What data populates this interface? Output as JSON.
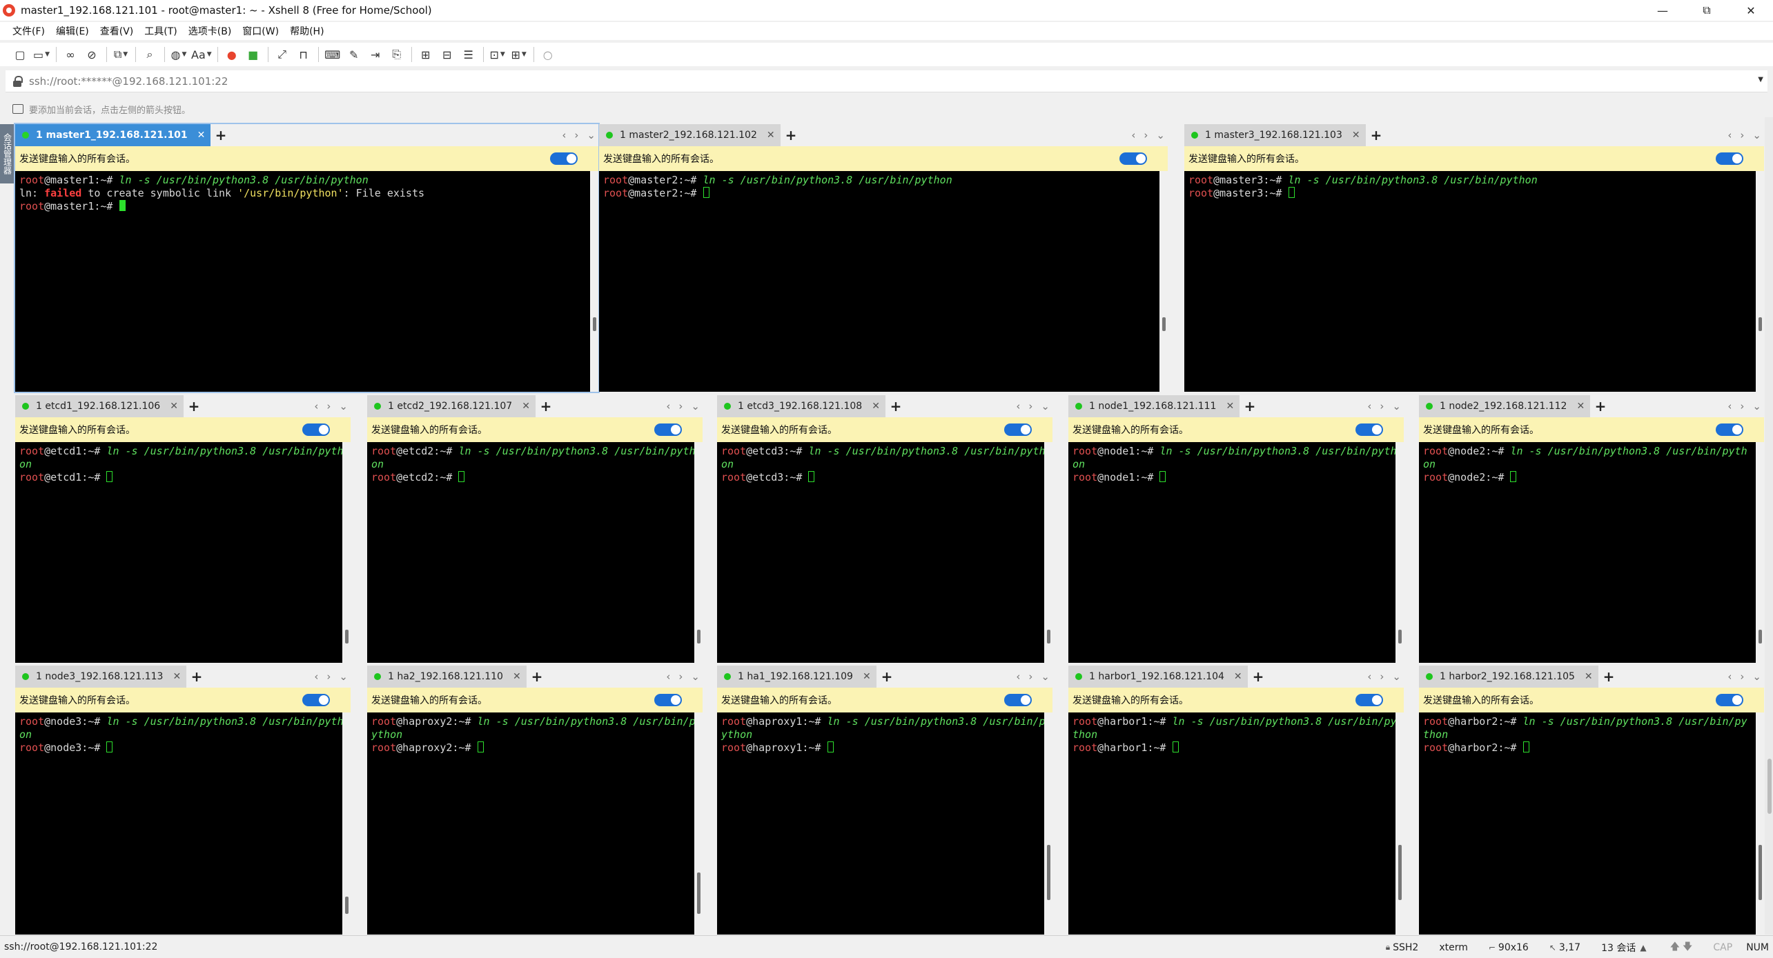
{
  "window": {
    "title": "master1_192.168.121.101 - root@master1: ~ - Xshell 8 (Free for Home/School)",
    "controls": {
      "minimize": "—",
      "restore": "⧉",
      "close": "✕"
    }
  },
  "menu": [
    "文件(F)",
    "编辑(E)",
    "查看(V)",
    "工具(T)",
    "选项卡(B)",
    "窗口(W)",
    "帮助(H)"
  ],
  "address": {
    "value": "ssh://root:******@192.168.121.101:22"
  },
  "hint": "要添加当前会话，点击左侧的箭头按钮。",
  "sidebar_label": "会话管理器",
  "send_label": "发送键盘输入的所有会话。",
  "status": {
    "left": "ssh://root@192.168.121.101:22",
    "protocol": "SSH2",
    "term": "xterm",
    "size": "90x16",
    "pos": "3,17",
    "sessions": "13 会话",
    "cap": "CAP",
    "num": "NUM"
  },
  "panes": [
    {
      "tab": "1 master1_192.168.121.101",
      "active": true,
      "host": "master1",
      "lines": [
        [
          [
            "p-root",
            "root"
          ],
          [
            "p-host",
            "@master1:~# "
          ],
          [
            "c-cmd",
            "ln -s /usr/bin/python3.8 /usr/bin/python"
          ]
        ],
        [
          [
            "c-plain",
            "ln: "
          ],
          [
            "c-red",
            "failed"
          ],
          [
            "c-plain",
            " to create symbolic link "
          ],
          [
            "c-str",
            "'/usr/bin/python'"
          ],
          [
            "c-plain",
            ": File exists"
          ]
        ],
        [
          [
            "p-root",
            "root"
          ],
          [
            "p-host",
            "@master1:~# "
          ],
          [
            "cursor",
            "block"
          ]
        ]
      ]
    },
    {
      "tab": "1 master2_192.168.121.102",
      "active": false,
      "host": "master2",
      "lines": [
        [
          [
            "p-root",
            "root"
          ],
          [
            "p-host",
            "@master2:~# "
          ],
          [
            "c-cmd",
            "ln -s /usr/bin/python3.8 /usr/bin/python"
          ]
        ],
        [
          [
            "p-root",
            "root"
          ],
          [
            "p-host",
            "@master2:~# "
          ],
          [
            "cursor",
            "hollow"
          ]
        ]
      ]
    },
    {
      "tab": "1 master3_192.168.121.103",
      "active": false,
      "host": "master3",
      "lines": [
        [
          [
            "p-root",
            "root"
          ],
          [
            "p-host",
            "@master3:~# "
          ],
          [
            "c-cmd",
            "ln -s /usr/bin/python3.8 /usr/bin/python"
          ]
        ],
        [
          [
            "p-root",
            "root"
          ],
          [
            "p-host",
            "@master3:~# "
          ],
          [
            "cursor",
            "hollow"
          ]
        ]
      ]
    },
    {
      "tab": "1 etcd1_192.168.121.106",
      "active": false,
      "host": "etcd1",
      "lines": [
        [
          [
            "p-root",
            "root"
          ],
          [
            "p-host",
            "@etcd1:~# "
          ],
          [
            "c-cmd",
            "ln -s /usr/bin/python3.8 /usr/bin/pyth"
          ]
        ],
        [
          [
            "c-cmd",
            "on"
          ]
        ],
        [
          [
            "p-root",
            "root"
          ],
          [
            "p-host",
            "@etcd1:~# "
          ],
          [
            "cursor",
            "hollow"
          ]
        ]
      ]
    },
    {
      "tab": "1 etcd2_192.168.121.107",
      "active": false,
      "host": "etcd2",
      "lines": [
        [
          [
            "p-root",
            "root"
          ],
          [
            "p-host",
            "@etcd2:~# "
          ],
          [
            "c-cmd",
            "ln -s /usr/bin/python3.8 /usr/bin/pyth"
          ]
        ],
        [
          [
            "c-cmd",
            "on"
          ]
        ],
        [
          [
            "p-root",
            "root"
          ],
          [
            "p-host",
            "@etcd2:~# "
          ],
          [
            "cursor",
            "hollow"
          ]
        ]
      ]
    },
    {
      "tab": "1 etcd3_192.168.121.108",
      "active": false,
      "host": "etcd3",
      "lines": [
        [
          [
            "p-root",
            "root"
          ],
          [
            "p-host",
            "@etcd3:~# "
          ],
          [
            "c-cmd",
            "ln -s /usr/bin/python3.8 /usr/bin/pyth"
          ]
        ],
        [
          [
            "c-cmd",
            "on"
          ]
        ],
        [
          [
            "p-root",
            "root"
          ],
          [
            "p-host",
            "@etcd3:~# "
          ],
          [
            "cursor",
            "hollow"
          ]
        ]
      ]
    },
    {
      "tab": "1 node1_192.168.121.111",
      "active": false,
      "host": "node1",
      "lines": [
        [
          [
            "p-root",
            "root"
          ],
          [
            "p-host",
            "@node1:~# "
          ],
          [
            "c-cmd",
            "ln -s /usr/bin/python3.8 /usr/bin/pyth"
          ]
        ],
        [
          [
            "c-cmd",
            "on"
          ]
        ],
        [
          [
            "p-root",
            "root"
          ],
          [
            "p-host",
            "@node1:~# "
          ],
          [
            "cursor",
            "hollow"
          ]
        ]
      ]
    },
    {
      "tab": "1 node2_192.168.121.112",
      "active": false,
      "host": "node2",
      "lines": [
        [
          [
            "p-root",
            "root"
          ],
          [
            "p-host",
            "@node2:~# "
          ],
          [
            "c-cmd",
            "ln -s /usr/bin/python3.8 /usr/bin/pyth"
          ]
        ],
        [
          [
            "c-cmd",
            "on"
          ]
        ],
        [
          [
            "p-root",
            "root"
          ],
          [
            "p-host",
            "@node2:~# "
          ],
          [
            "cursor",
            "hollow"
          ]
        ]
      ]
    },
    {
      "tab": "1 node3_192.168.121.113",
      "active": false,
      "host": "node3",
      "lines": [
        [
          [
            "p-root",
            "root"
          ],
          [
            "p-host",
            "@node3:~# "
          ],
          [
            "c-cmd",
            "ln -s /usr/bin/python3.8 /usr/bin/pyth"
          ]
        ],
        [
          [
            "c-cmd",
            "on"
          ]
        ],
        [
          [
            "p-root",
            "root"
          ],
          [
            "p-host",
            "@node3:~# "
          ],
          [
            "cursor",
            "hollow"
          ]
        ]
      ]
    },
    {
      "tab": "1 ha2_192.168.121.110",
      "active": false,
      "host": "haproxy2",
      "lines": [
        [
          [
            "p-root",
            "root"
          ],
          [
            "p-host",
            "@haproxy2:~# "
          ],
          [
            "c-cmd",
            "ln -s /usr/bin/python3.8 /usr/bin/p"
          ]
        ],
        [
          [
            "c-cmd",
            "ython"
          ]
        ],
        [
          [
            "p-root",
            "root"
          ],
          [
            "p-host",
            "@haproxy2:~# "
          ],
          [
            "cursor",
            "hollow"
          ]
        ]
      ]
    },
    {
      "tab": "1 ha1_192.168.121.109",
      "active": false,
      "host": "haproxy1",
      "lines": [
        [
          [
            "p-root",
            "root"
          ],
          [
            "p-host",
            "@haproxy1:~# "
          ],
          [
            "c-cmd",
            "ln -s /usr/bin/python3.8 /usr/bin/p"
          ]
        ],
        [
          [
            "c-cmd",
            "ython"
          ]
        ],
        [
          [
            "p-root",
            "root"
          ],
          [
            "p-host",
            "@haproxy1:~# "
          ],
          [
            "cursor",
            "hollow"
          ]
        ]
      ]
    },
    {
      "tab": "1 harbor1_192.168.121.104",
      "active": false,
      "host": "harbor1",
      "lines": [
        [
          [
            "p-root",
            "root"
          ],
          [
            "p-host",
            "@harbor1:~# "
          ],
          [
            "c-cmd",
            "ln -s /usr/bin/python3.8 /usr/bin/py"
          ]
        ],
        [
          [
            "c-cmd",
            "thon"
          ]
        ],
        [
          [
            "p-root",
            "root"
          ],
          [
            "p-host",
            "@harbor1:~# "
          ],
          [
            "cursor",
            "hollow"
          ]
        ]
      ]
    },
    {
      "tab": "1 harbor2_192.168.121.105",
      "active": false,
      "host": "harbor2",
      "lines": [
        [
          [
            "p-root",
            "root"
          ],
          [
            "p-host",
            "@harbor2:~# "
          ],
          [
            "c-cmd",
            "ln -s /usr/bin/python3.8 /usr/bin/py"
          ]
        ],
        [
          [
            "c-cmd",
            "thon"
          ]
        ],
        [
          [
            "p-root",
            "root"
          ],
          [
            "p-host",
            "@harbor2:~# "
          ],
          [
            "cursor",
            "hollow"
          ]
        ]
      ]
    }
  ]
}
